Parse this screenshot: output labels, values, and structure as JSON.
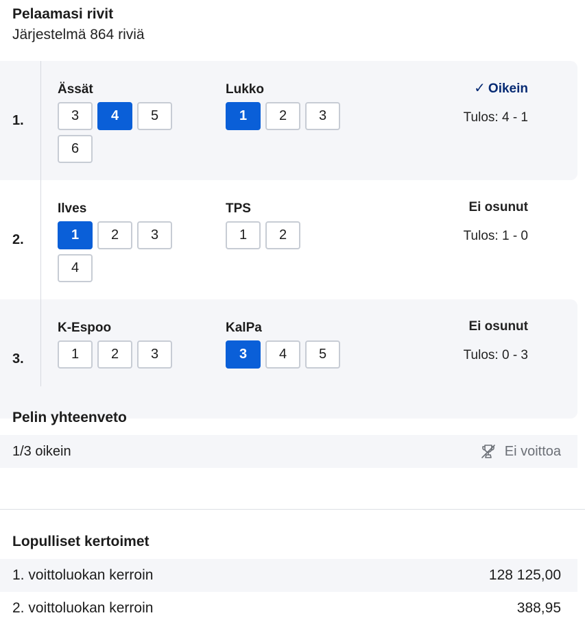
{
  "header": {
    "title": "Pelaamasi rivit",
    "subtitle": "Järjestelmä 864 riviä"
  },
  "rows": [
    {
      "num": "1.",
      "home": {
        "name": "Ässät",
        "options": [
          {
            "label": "3",
            "selected": false
          },
          {
            "label": "4",
            "selected": true
          },
          {
            "label": "5",
            "selected": false
          },
          {
            "label": "6",
            "selected": false
          }
        ]
      },
      "away": {
        "name": "Lukko",
        "options": [
          {
            "label": "1",
            "selected": true
          },
          {
            "label": "2",
            "selected": false
          },
          {
            "label": "3",
            "selected": false
          }
        ]
      },
      "status": "Oikein",
      "correct": true,
      "score": "Tulos: 4 - 1"
    },
    {
      "num": "2.",
      "home": {
        "name": "Ilves",
        "options": [
          {
            "label": "1",
            "selected": true
          },
          {
            "label": "2",
            "selected": false
          },
          {
            "label": "3",
            "selected": false
          },
          {
            "label": "4",
            "selected": false
          }
        ]
      },
      "away": {
        "name": "TPS",
        "options": [
          {
            "label": "1",
            "selected": false
          },
          {
            "label": "2",
            "selected": false
          }
        ]
      },
      "status": "Ei osunut",
      "correct": false,
      "score": "Tulos: 1 - 0"
    },
    {
      "num": "3.",
      "home": {
        "name": "K-Espoo",
        "options": [
          {
            "label": "1",
            "selected": false
          },
          {
            "label": "2",
            "selected": false
          },
          {
            "label": "3",
            "selected": false
          }
        ]
      },
      "away": {
        "name": "KalPa",
        "options": [
          {
            "label": "3",
            "selected": true
          },
          {
            "label": "4",
            "selected": false
          },
          {
            "label": "5",
            "selected": false
          }
        ]
      },
      "status": "Ei osunut",
      "correct": false,
      "score": "Tulos: 0 - 3"
    }
  ],
  "summary": {
    "title": "Pelin yhteenveto",
    "correct_count": "1/3 oikein",
    "prize": "Ei voittoa",
    "prize_icon": "trophy-icon"
  },
  "odds": {
    "title": "Lopulliset kertoimet",
    "items": [
      {
        "label": "1. voittoluokan kerroin",
        "value": "128 125,00"
      },
      {
        "label": "2. voittoluokan kerroin",
        "value": "388,95"
      }
    ]
  },
  "colors": {
    "selected": "#0a5fd8",
    "correct_text": "#062a73",
    "row_bg": "#f5f6f9"
  }
}
